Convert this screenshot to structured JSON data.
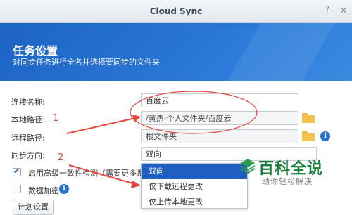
{
  "window": {
    "title": "Cloud Sync",
    "help_label": "?",
    "close_label": "×"
  },
  "header": {
    "title": "任务设置",
    "subtitle": "对同步任务进行全名并选择要同步的文件夹"
  },
  "form": {
    "connection_name": {
      "label": "连接名称:",
      "value": "百度云"
    },
    "local_path": {
      "label": "本地路径:",
      "value": "/黄杰-个人文件夹/百度云"
    },
    "remote_path": {
      "label": "远程路径:",
      "value": "根文件夹"
    },
    "sync_direction": {
      "label": "同步方向:",
      "value": "双向"
    },
    "advanced_check": {
      "label": "启用高级一致性检测（需要更多系统资",
      "checked": true
    },
    "encryption": {
      "label": "数据加密",
      "checked": false
    },
    "plan_button": "计划设置"
  },
  "dropdown": {
    "options": [
      "双向",
      "仅下载远程更改",
      "仅上传本地更改"
    ],
    "selected_index": 0
  },
  "annotations": {
    "num1": "1",
    "num2": "2"
  },
  "watermark": {
    "title": "百科全说",
    "subtitle": "助你轻松解决"
  },
  "colors": {
    "header_blue": "#1d63c4",
    "selection_blue": "#1f5fbf",
    "annotation_red": "#e8453c",
    "watermark_green": "#1a7d3a"
  }
}
